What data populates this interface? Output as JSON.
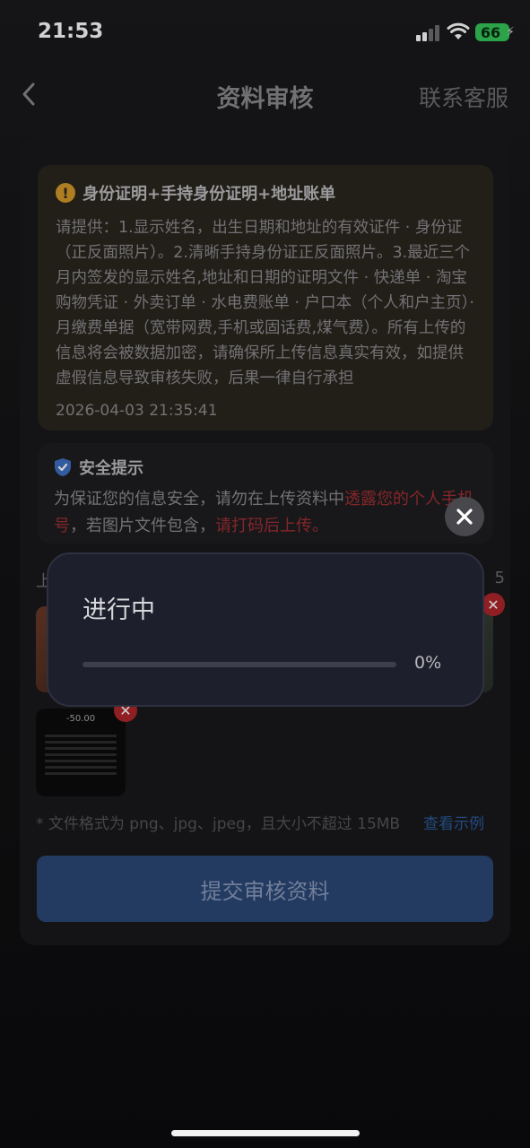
{
  "status_bar": {
    "time": "21:53",
    "battery": "66"
  },
  "nav": {
    "title": "资料审核",
    "right": "联系客服"
  },
  "notice": {
    "title": "身份证明+手持身份证明+地址账单",
    "body": "请提供：1.显示姓名，出生日期和地址的有效证件 · 身份证（正反面照片）。2.清晰手持身份证正反面照片。3.最近三个月内签发的显示姓名,地址和日期的证明文件 · 快递单 · 淘宝购物凭证 · 外卖订单 · 水电费账单 · 户口本（个人和户主页）· 月缴费单据（宽带网费,手机或固话费,煤气费）。所有上传的信息将会被数据加密，请确保所上传信息真实有效，如提供虚假信息导致审核失败，后果一律自行承担",
    "date": "2026-04-03 21:35:41"
  },
  "safety": {
    "title": "安全提示",
    "text_1": "为保证您的信息安全，请勿在上传资料中",
    "red_1": "透露您的个人手机号",
    "text_2": "，若图片文件包含，",
    "red_2": "请打码后上传。"
  },
  "upload": {
    "label": "上",
    "count": "5",
    "receipt_amount": "-50.00",
    "hint": "* 文件格式为 png、jpg、jpeg，且大小不超过 15MB",
    "example_link": "查看示例"
  },
  "submit_label": "提交审核资料",
  "dialog": {
    "title": "进行中",
    "progress_percent": 0,
    "progress_text": "0%"
  },
  "colors": {
    "accent": "#2b4777",
    "warning": "#d59a2a",
    "danger": "#b0262b",
    "battery": "#35c759"
  }
}
